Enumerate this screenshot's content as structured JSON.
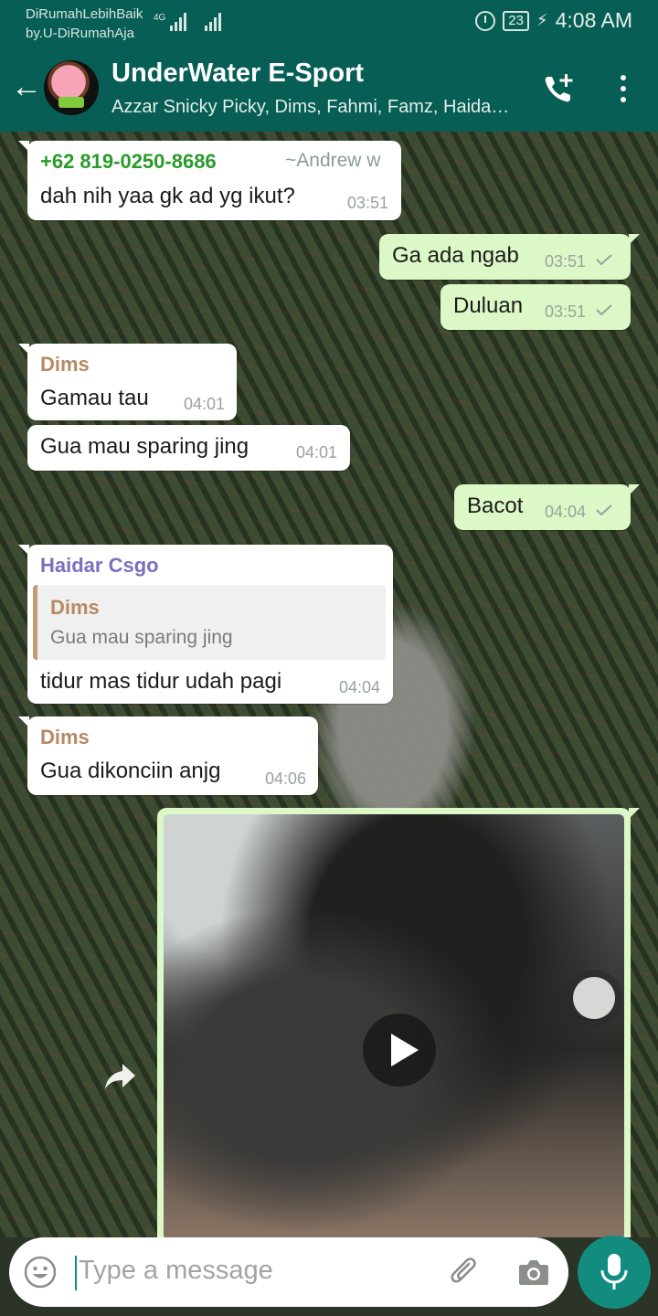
{
  "status_bar": {
    "carrier_line1": "DiRumahLebihBaik",
    "carrier_line2": "by.U-DiRumahAja",
    "network": "4G",
    "battery": "23",
    "time": "4:08 AM"
  },
  "header": {
    "title": "UnderWater E-Sport",
    "members": "Azzar Snicky Picky, Dims, Fahmi, Famz, Haidar Csgo",
    "icons": [
      "back-arrow-icon",
      "group-avatar",
      "add-call-icon",
      "more-vert-icon"
    ]
  },
  "messages": [
    {
      "type": "incoming",
      "sender": "+62 819-0250-8686",
      "sender_color": "#2a9a2a",
      "alias": "~Andrew w",
      "text": "dah nih yaa gk ad yg ikut?",
      "time": "03:51"
    },
    {
      "type": "outgoing",
      "text": "Ga ada ngab",
      "time": "03:51",
      "status": "read"
    },
    {
      "type": "outgoing",
      "text": "Duluan",
      "time": "03:51",
      "status": "read"
    },
    {
      "type": "incoming",
      "sender": "Dims",
      "sender_color": "#b58a63",
      "text": "Gamau tau",
      "time": "04:01"
    },
    {
      "type": "incoming",
      "text": "Gua mau sparing jing",
      "time": "04:01"
    },
    {
      "type": "outgoing",
      "text": "Bacot",
      "time": "04:04",
      "status": "read"
    },
    {
      "type": "incoming",
      "sender": "Haidar Csgo",
      "sender_color": "#7b6fbf",
      "quote_sender": "Dims",
      "quote_text": "Gua mau sparing jing",
      "text": "tidur mas tidur udah pagi",
      "time": "04:04"
    },
    {
      "type": "incoming",
      "sender": "Dims",
      "sender_color": "#b58a63",
      "text": "Gua dikonciin anjg",
      "time": "04:06"
    },
    {
      "type": "outgoing-video",
      "icon": "play-icon"
    }
  ],
  "composer": {
    "placeholder": "Type a message",
    "icons": [
      "emoji-icon",
      "attach-icon",
      "camera-icon",
      "mic-icon"
    ]
  },
  "colors": {
    "header_bg": "#075e54",
    "outgoing_bubble": "#dcf8c6",
    "incoming_bubble": "#ffffff",
    "accent": "#128c7e"
  }
}
